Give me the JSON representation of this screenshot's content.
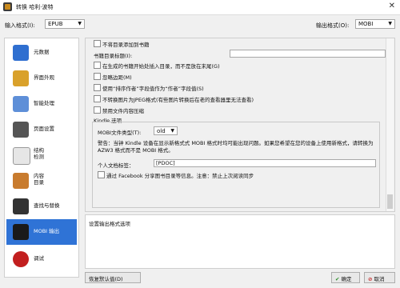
{
  "window": {
    "title": "转换 哈利·波特"
  },
  "toolbar": {
    "input_format_label": "输入格式(I):",
    "input_format_value": "EPUB",
    "output_format_label": "输出格式(O):",
    "output_format_value": "MOBI"
  },
  "sidebar": {
    "items": [
      {
        "label": "元数据"
      },
      {
        "label": "界面外观"
      },
      {
        "label": "智能处理"
      },
      {
        "label": "页面设置"
      },
      {
        "label": "结构\n检测"
      },
      {
        "label": "内容\n目录"
      },
      {
        "label": "查找与替换"
      },
      {
        "label": "MOBI 输出"
      },
      {
        "label": "调试"
      }
    ],
    "selected_index": 7
  },
  "options": {
    "no_inline_toc": "不将目录添加到书籍",
    "toc_title_label": "书籍目录标题(I):",
    "toc_title_value": "",
    "toc_at_start": "在生成的书籍开始处插入目录，而不是放在末尾(G)",
    "ignore_margins": "忽略边距(M)",
    "prefer_author_sort": "使用“排序作者”字段值作为“作者”字段值(S)",
    "no_jpeg_convert": "不转换图片为JPEG格式(有些图片转换后在老的查看器里无法查看)",
    "no_compress": "禁用文件内容压缩",
    "kindle_section": "Kindle 选项",
    "mobi_type_label": "MOBI文件类型(T):",
    "mobi_type_value": "old",
    "warning_text_1": "警告：当钟 Kindle 设备在显示新格式式 MOBI 格式时均可能出现问题。如果您希望在您的设备上使用新格式，请转换为 AZW3 格式而不是 MOBI 格式。",
    "personal_doc_label": "个人文档标签：",
    "personal_doc_value": "[PDOC]",
    "share_facebook": "通过 Facebook 分享图书目录等信息。注意：禁止上次阅读同步"
  },
  "help": {
    "text": "设置输出格式选项"
  },
  "footer": {
    "restore_label": "恢复默认值(D)",
    "ok_label": "确定",
    "cancel_label": "取消"
  }
}
